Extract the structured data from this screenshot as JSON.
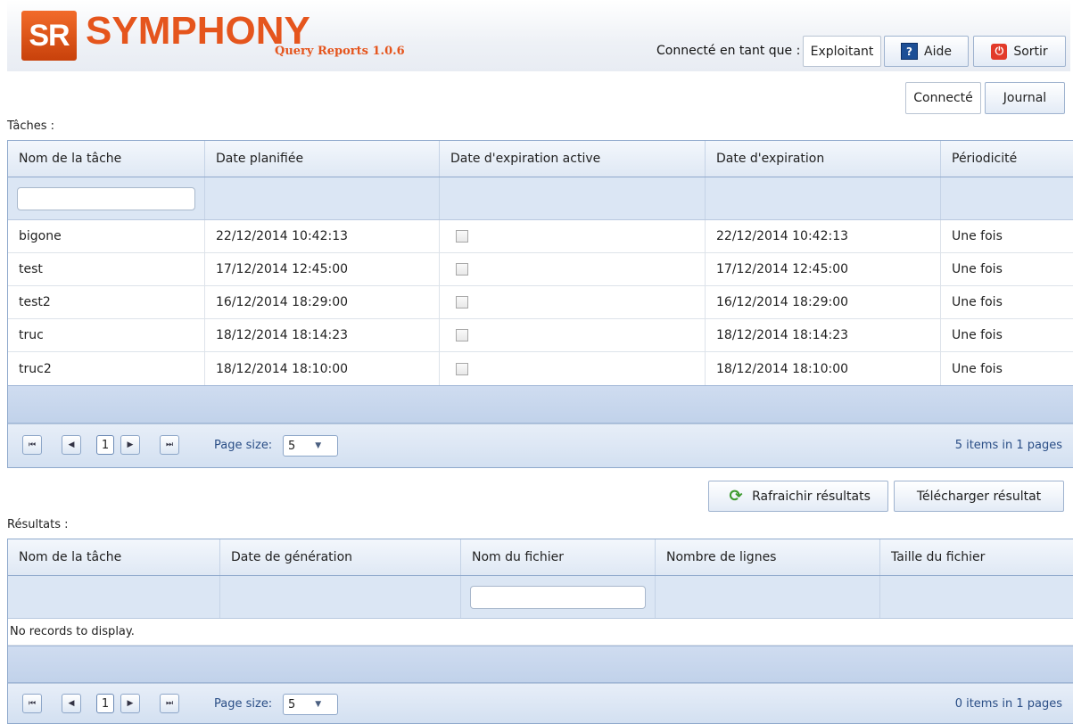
{
  "header": {
    "logo_mark": "SR",
    "logo_text": "SYMPHONY",
    "app_subtitle": "Query Reports 1.0.6",
    "connected_as_label": "Connecté en tant que :",
    "user_name": "Exploitant",
    "help_label": "Aide",
    "logout_label": "Sortir"
  },
  "toolbar": {
    "connected_label": "Connecté",
    "journal_label": "Journal"
  },
  "tasks": {
    "section_label": "Tâches :",
    "columns": [
      "Nom de la tâche",
      "Date planifiée",
      "Date d'expiration active",
      "Date d'expiration",
      "Périodicité"
    ],
    "filter_placeholder": "",
    "rows": [
      {
        "name": "bigone",
        "planned": "22/12/2014 10:42:13",
        "expiration_active": false,
        "expiration": "22/12/2014 10:42:13",
        "periodicity": "Une fois"
      },
      {
        "name": "test",
        "planned": "17/12/2014 12:45:00",
        "expiration_active": false,
        "expiration": "17/12/2014 12:45:00",
        "periodicity": "Une fois"
      },
      {
        "name": "test2",
        "planned": "16/12/2014 18:29:00",
        "expiration_active": false,
        "expiration": "16/12/2014 18:29:00",
        "periodicity": "Une fois"
      },
      {
        "name": "truc",
        "planned": "18/12/2014 18:14:23",
        "expiration_active": false,
        "expiration": "18/12/2014 18:14:23",
        "periodicity": "Une fois"
      },
      {
        "name": "truc2",
        "planned": "18/12/2014 18:10:00",
        "expiration_active": false,
        "expiration": "18/12/2014 18:10:00",
        "periodicity": "Une fois"
      }
    ],
    "pager": {
      "first_icon": "first-page-icon",
      "prev_icon": "prev-page-icon",
      "current_page": "1",
      "next_icon": "next-page-icon",
      "last_icon": "last-page-icon",
      "page_size_label": "Page size:",
      "page_size_value": "5",
      "info": "5 items in 1 pages"
    }
  },
  "actions": {
    "refresh_label": "Rafraichir résultats",
    "download_label": "Télécharger résultat"
  },
  "results": {
    "section_label": "Résultats :",
    "columns": [
      "Nom de la tâche",
      "Date de génération",
      "Nom du fichier",
      "Nombre de lignes",
      "Taille du fichier"
    ],
    "filter_placeholder": "",
    "empty_message": "No records to display.",
    "pager": {
      "current_page": "1",
      "page_size_label": "Page size:",
      "page_size_value": "5",
      "info": "0 items in 1 pages"
    }
  },
  "colors": {
    "brand_orange": "#e5551d",
    "grid_border": "#8fa9cc",
    "pager_text": "#2a4e86"
  }
}
